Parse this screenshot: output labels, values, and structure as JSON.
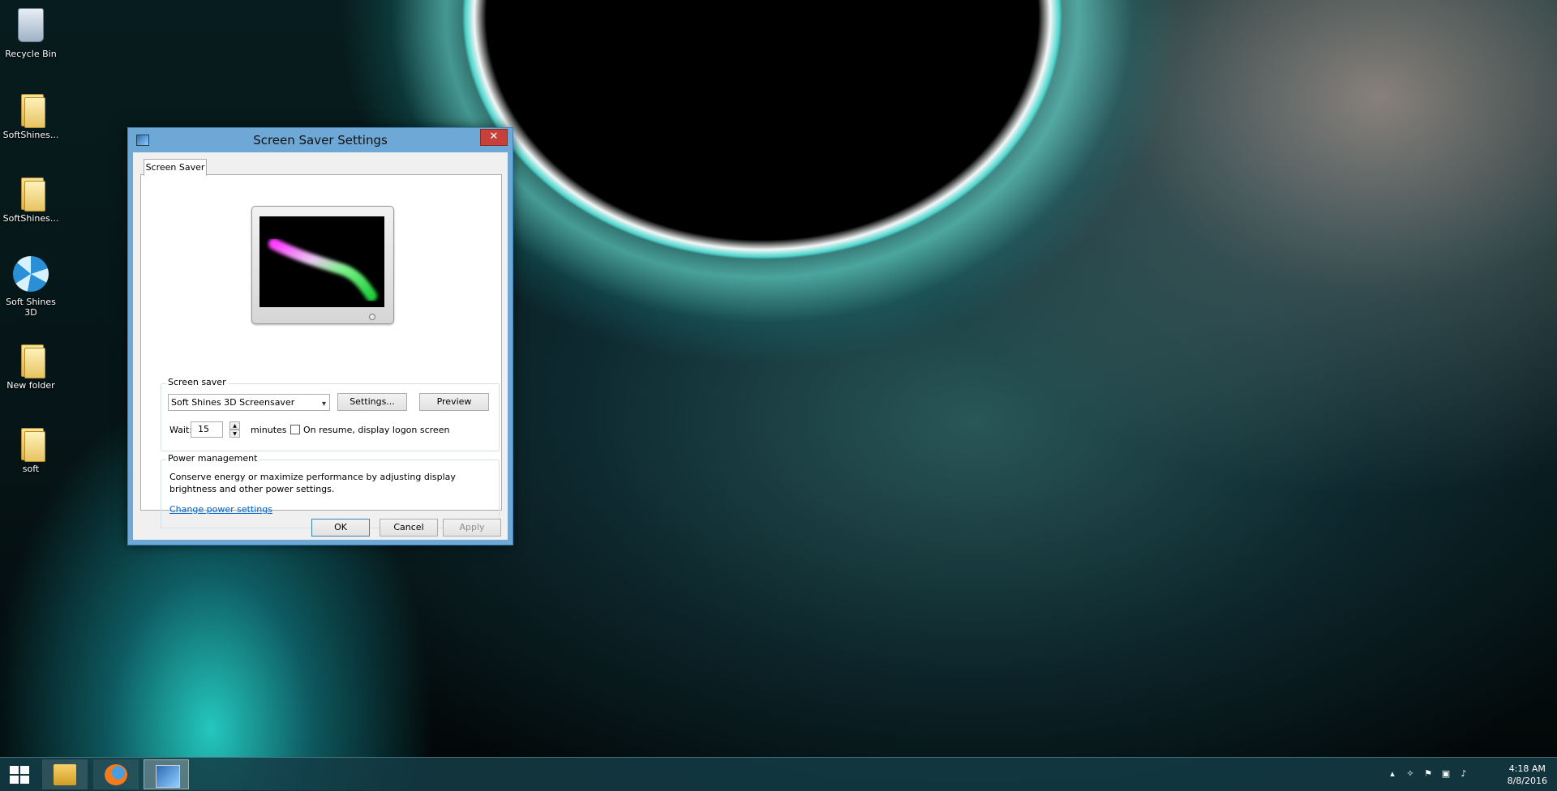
{
  "desktop": {
    "icons": [
      {
        "label": "Recycle Bin",
        "icon": "recycle-bin-icon"
      },
      {
        "label": "SoftShines...",
        "icon": "folder-zip-icon"
      },
      {
        "label": "SoftShines...",
        "icon": "folder-icon"
      },
      {
        "label": "Soft Shines 3D",
        "icon": "soft-shines-icon"
      },
      {
        "label": "New folder",
        "icon": "folder-icon"
      },
      {
        "label": "soft",
        "icon": "folder-icon"
      }
    ]
  },
  "dialog": {
    "title": "Screen Saver Settings",
    "close_glyph": "✕",
    "tab_label": "Screen Saver",
    "screen_saver_group": {
      "title": "Screen saver",
      "selected": "Soft Shines 3D Screensaver",
      "settings_label": "Settings...",
      "preview_label": "Preview",
      "wait_label": "Wait:",
      "wait_value": "15",
      "minutes_label": "minutes",
      "resume_label": "On resume, display logon screen",
      "resume_checked": false
    },
    "power_group": {
      "title": "Power management",
      "text": "Conserve energy or maximize performance by adjusting display brightness and other power settings.",
      "link": "Change power settings"
    },
    "buttons": {
      "ok": "OK",
      "cancel": "Cancel",
      "apply": "Apply"
    }
  },
  "taskbar": {
    "items": [
      "file-explorer-icon",
      "firefox-icon",
      "screen-saver-settings-icon"
    ],
    "tray": {
      "time": "4:18 AM",
      "date": "8/8/2016"
    }
  },
  "colors": {
    "accent": "#6ea8d6",
    "close": "#c7413a",
    "link": "#0066cc",
    "taskbar": "#143c46"
  }
}
